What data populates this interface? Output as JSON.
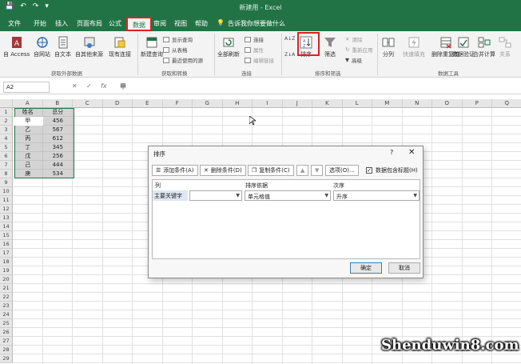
{
  "window": {
    "title": "新建用 - Excel",
    "qat": [
      "💾",
      "↶",
      "↷",
      "▾"
    ]
  },
  "ribbon_tabs": [
    "文件",
    "开始",
    "插入",
    "页面布局",
    "公式",
    "数据",
    "审阅",
    "视图",
    "帮助"
  ],
  "tell_me": "告诉我你想要做什么",
  "active_tab": "数据",
  "groups": {
    "external": {
      "label": "获取外部数据",
      "buttons": [
        "自 Access",
        "自网站",
        "自文本",
        "自其他来源",
        "现有连接"
      ]
    },
    "transform": {
      "label": "获取和转换",
      "new_query": "新建查询",
      "items": [
        "显示查询",
        "从表格",
        "最近使用的源"
      ]
    },
    "connections": {
      "label": "连接",
      "refresh": "全部刷新",
      "items": [
        "连接",
        "属性",
        "编辑链接"
      ]
    },
    "sort_filter": {
      "label": "排序和筛选",
      "az": "A↓Z",
      "za": "Z↓A",
      "sort": "排序",
      "filter": "筛选",
      "items": [
        "清除",
        "重新应用",
        "高级"
      ]
    },
    "data_tools": {
      "label": "数据工具",
      "buttons": [
        "分列",
        "快速填充",
        "删除重复值",
        "数据验证",
        "合并计算",
        "关系"
      ]
    }
  },
  "formula_bar": {
    "name_box": "A2",
    "cancel": "✕",
    "enter": "✓",
    "fx": "fx",
    "value": "甲"
  },
  "columns": [
    "A",
    "B",
    "C",
    "D",
    "E",
    "F",
    "G",
    "H",
    "I",
    "J",
    "K",
    "L",
    "M",
    "N",
    "O",
    "P",
    "Q"
  ],
  "rows": [
    "1",
    "2",
    "3",
    "4",
    "5",
    "6",
    "7",
    "8",
    "9",
    "10",
    "11",
    "12",
    "13",
    "14",
    "15",
    "16",
    "17",
    "18",
    "19",
    "20",
    "21",
    "22",
    "23",
    "24",
    "25",
    "26",
    "27",
    "28",
    "29"
  ],
  "sheet_data": {
    "header": [
      "姓名",
      "总分"
    ],
    "records": [
      [
        "甲",
        "456"
      ],
      [
        "乙",
        "567"
      ],
      [
        "丙",
        "612"
      ],
      [
        "丁",
        "345"
      ],
      [
        "戊",
        "256"
      ],
      [
        "己",
        "444"
      ],
      [
        "庚",
        "534"
      ]
    ]
  },
  "sort_dialog": {
    "title": "排序",
    "help": "?",
    "close": "✕",
    "add_level": "添加条件(A)",
    "delete_level": "删除条件(D)",
    "copy_level": "复制条件(C)",
    "move_up": "▲",
    "move_down": "▼",
    "options": "选项(O)...",
    "has_headers": "数据包含标题(H)",
    "has_headers_checked": true,
    "checkmark": "✓",
    "col_header": "列",
    "sort_on_header": "排序依据",
    "order_header": "次序",
    "row_label": "主要关键字",
    "sort_on_value": "单元格值",
    "order_value": "升序",
    "column_value": "",
    "ok": "确定",
    "cancel": "取消"
  },
  "watermark": "Shenduwin8.com",
  "colors": {
    "excel_green": "#217346",
    "highlight_red": "#e02020"
  }
}
